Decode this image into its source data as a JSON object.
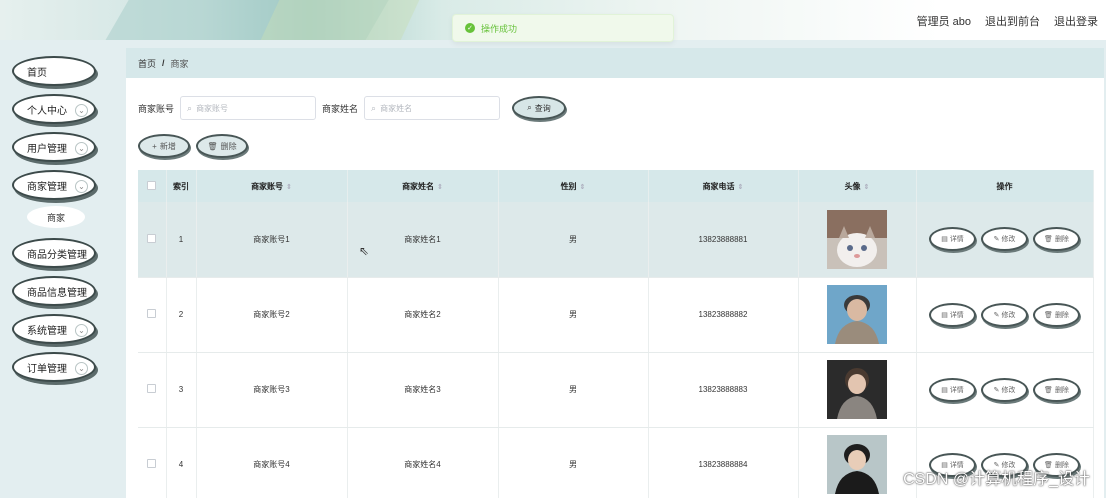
{
  "header": {
    "title_fragment": "",
    "user_label": "管理员 abo",
    "back_to_front": "退出到前台",
    "logout": "退出登录"
  },
  "toast": {
    "message": "操作成功"
  },
  "sidebar": {
    "items": [
      {
        "label": "首页",
        "has_chevron": false
      },
      {
        "label": "个人中心",
        "has_chevron": true
      },
      {
        "label": "用户管理",
        "has_chevron": true
      },
      {
        "label": "商家管理",
        "has_chevron": true
      },
      {
        "label": "商品分类管理",
        "has_chevron": true
      },
      {
        "label": "商品信息管理",
        "has_chevron": true
      },
      {
        "label": "系统管理",
        "has_chevron": true
      },
      {
        "label": "订单管理",
        "has_chevron": true
      }
    ],
    "sub_item": "商家"
  },
  "breadcrumb": {
    "home": "首页",
    "sep": "/",
    "current": "商家"
  },
  "search": {
    "account_label": "商家账号",
    "account_placeholder": "商家账号",
    "name_label": "商家姓名",
    "name_placeholder": "商家姓名",
    "query_label": "查询"
  },
  "actions": {
    "add_label": "新增",
    "delete_label": "删除"
  },
  "table": {
    "headers": [
      "索引",
      "商家账号",
      "商家姓名",
      "性别",
      "商家电话",
      "头像",
      "操作"
    ],
    "rows": [
      {
        "index": "1",
        "account": "商家账号1",
        "name": "商家姓名1",
        "gender": "男",
        "phone": "13823888881"
      },
      {
        "index": "2",
        "account": "商家账号2",
        "name": "商家姓名2",
        "gender": "男",
        "phone": "13823888882"
      },
      {
        "index": "3",
        "account": "商家账号3",
        "name": "商家姓名3",
        "gender": "男",
        "phone": "13823888883"
      },
      {
        "index": "4",
        "account": "商家账号4",
        "name": "商家姓名4",
        "gender": "男",
        "phone": "13823888884"
      }
    ],
    "op_detail": "详情",
    "op_edit": "修改",
    "op_delete": "删除"
  },
  "watermark": "CSDN @计算机程序_设计",
  "colors": {
    "accent_bg": "#d6e8ea",
    "success": "#67c23a",
    "pill_border": "#485656"
  }
}
